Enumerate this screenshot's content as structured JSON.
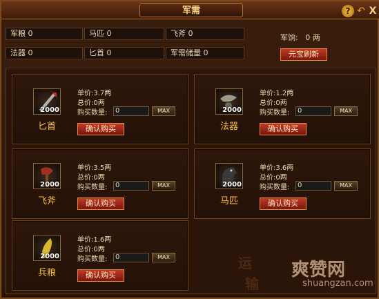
{
  "window": {
    "title": "军需",
    "help_label": "?",
    "back_label": "↶",
    "close_label": "X"
  },
  "stats": {
    "grain": {
      "label": "军粮",
      "value": "0"
    },
    "horse": {
      "label": "马匹",
      "value": "0"
    },
    "axe": {
      "label": "飞斧",
      "value": "0"
    },
    "magic": {
      "label": "法器",
      "value": "0"
    },
    "dagger": {
      "label": "匕首",
      "value": "0"
    },
    "reserve": {
      "label": "军需储量",
      "value": "0"
    }
  },
  "pay": {
    "label": "军饷:",
    "value": "0 两"
  },
  "refresh_label": "元宝刷新",
  "items": [
    {
      "name": "匕首",
      "icon": "dagger-icon",
      "qty": "2000",
      "price_label": "单价:",
      "price": "3.7两",
      "total_label": "总价:",
      "total": "0两",
      "count_label": "购买数量:",
      "count": "0",
      "max_label": "MAX",
      "buy_label": "确认购买"
    },
    {
      "name": "法器",
      "icon": "magic-tool-icon",
      "qty": "2000",
      "price_label": "单价:",
      "price": "1.2两",
      "total_label": "总价:",
      "total": "0两",
      "count_label": "购买数量:",
      "count": "0",
      "max_label": "MAX",
      "buy_label": "确认购买"
    },
    {
      "name": "飞斧",
      "icon": "axe-icon",
      "qty": "2000",
      "price_label": "单价:",
      "price": "3.5两",
      "total_label": "总价:",
      "total": "0两",
      "count_label": "购买数量:",
      "count": "0",
      "max_label": "MAX",
      "buy_label": "确认购买"
    },
    {
      "name": "马匹",
      "icon": "horse-icon",
      "qty": "2000",
      "price_label": "单价:",
      "price": "3.6两",
      "total_label": "总价:",
      "total": "0两",
      "count_label": "购买数量:",
      "count": "0",
      "max_label": "MAX",
      "buy_label": "确认购买"
    },
    {
      "name": "兵粮",
      "icon": "grain-icon",
      "qty": "2000",
      "price_label": "单价:",
      "price": "1.6两",
      "total_label": "总价:",
      "total": "0两",
      "count_label": "购买数量:",
      "count": "0",
      "max_label": "MAX",
      "buy_label": "确认购买"
    }
  ],
  "background_text": [
    "运",
    "输"
  ],
  "watermark": {
    "main": "爽赞网",
    "sub": "shuangzan.com"
  }
}
